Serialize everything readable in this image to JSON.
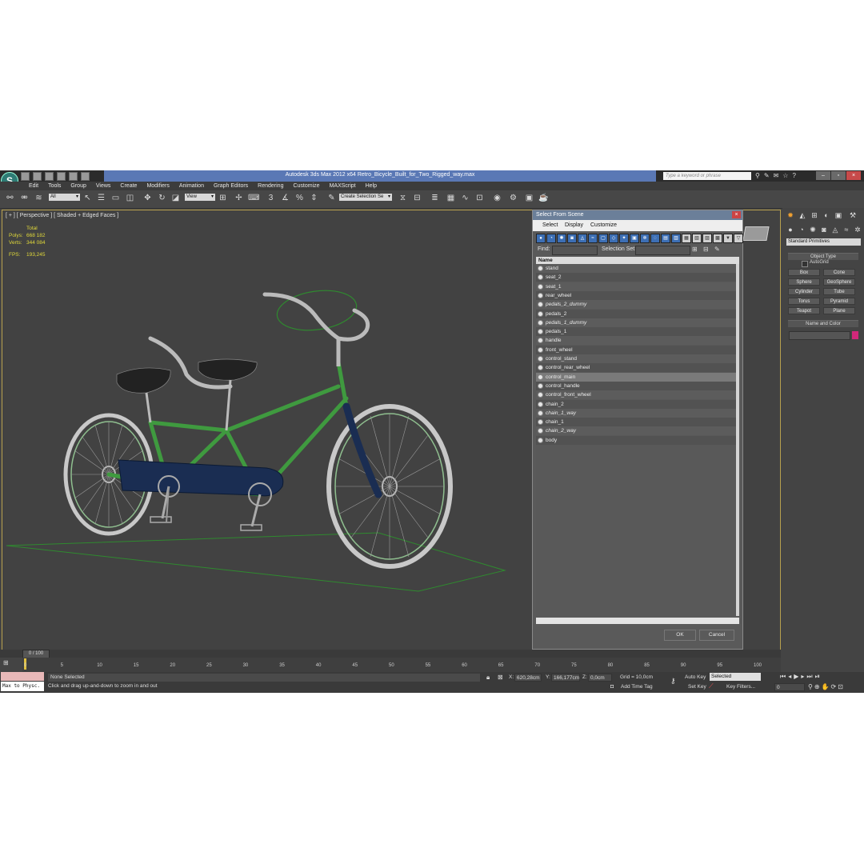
{
  "app": {
    "title": "Autodesk 3ds Max  2012 x64     Retro_Bicycle_Built_for_Two_Rigged_way.max",
    "search_placeholder": "Type a keyword or phrase",
    "logo_letter": "S"
  },
  "menu": [
    "Edit",
    "Tools",
    "Group",
    "Views",
    "Create",
    "Modifiers",
    "Animation",
    "Graph Editors",
    "Rendering",
    "Customize",
    "MAXScript",
    "Help"
  ],
  "toolbar": {
    "selection_filter": "All",
    "reference_coord": "View",
    "named_selection": "Create Selection Se"
  },
  "viewport": {
    "label": "[ + ] [ Perspective ] [ Shaded + Edged Faces ]",
    "stats": {
      "total_label": "Total",
      "polys_label": "Polys:",
      "polys": "668 182",
      "verts_label": "Verts:",
      "verts": "344 084",
      "fps_label": "FPS:",
      "fps": "193,245"
    }
  },
  "command_panel": {
    "category": "Standard Primitives",
    "object_type_header": "Object Type",
    "autogrid_label": "AutoGrid",
    "buttons": [
      "Box",
      "Cone",
      "Sphere",
      "GeoSphere",
      "Cylinder",
      "Tube",
      "Torus",
      "Pyramid",
      "Teapot",
      "Plane"
    ],
    "name_color_header": "Name and Color",
    "swatch_color": "#d0287a"
  },
  "dialog": {
    "title": "Select From Scene",
    "menu": [
      "Select",
      "Display",
      "Customize"
    ],
    "find_label": "Find:",
    "selection_set_label": "Selection Set:",
    "column_header": "Name",
    "items": [
      "stand",
      "seat_2",
      "seat_1",
      "rear_wheel",
      "pedals_2_dummy",
      "pedals_2",
      "pedals_1_dummy",
      "pedals_1",
      "handle",
      "front_wheel",
      "control_stand",
      "control_rear_wheel",
      "control_main",
      "control_handle",
      "control_front_wheel",
      "chain_2",
      "chain_1_way",
      "chain_1",
      "chain_2_way",
      "body"
    ],
    "ok_label": "OK",
    "cancel_label": "Cancel"
  },
  "timeline": {
    "position": "0 / 100",
    "ticks": [
      "0",
      "5",
      "10",
      "15",
      "20",
      "25",
      "30",
      "35",
      "40",
      "45",
      "50",
      "55",
      "60",
      "65",
      "70",
      "75",
      "80",
      "85",
      "90",
      "95",
      "100"
    ]
  },
  "status": {
    "maxscript_listener": "Max to Physc.",
    "selection": "None Selected",
    "prompt": "Click and drag up-and-down to zoom in and out",
    "x_label": "X:",
    "x_value": "620,28cm",
    "y_label": "Y:",
    "y_value": "166,177cm",
    "z_label": "Z:",
    "z_value": "0,0cm",
    "grid": "Grid = 10,0cm",
    "add_time_tag": "Add Time Tag",
    "auto_key": "Auto Key",
    "set_key": "Set Key",
    "key_mode": "Selected",
    "key_filters": "Key Filters...",
    "frame": "0"
  }
}
